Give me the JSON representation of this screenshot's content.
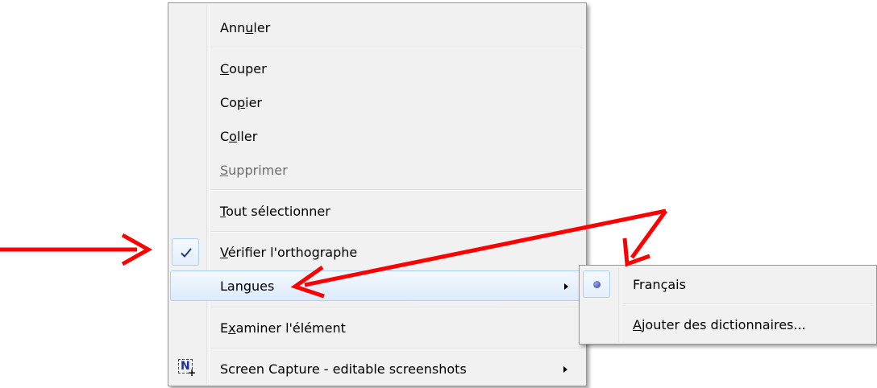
{
  "context_menu": {
    "items": [
      {
        "label_pre": "Ann",
        "accel": "u",
        "label_post": "ler"
      },
      {
        "label_pre": "",
        "accel": "C",
        "label_post": "ouper"
      },
      {
        "label_pre": "Co",
        "accel": "p",
        "label_post": "ier"
      },
      {
        "label_pre": "C",
        "accel": "o",
        "label_post": "ller"
      },
      {
        "label_pre": "",
        "accel": "S",
        "label_post": "upprimer",
        "disabled": true
      },
      {
        "label_pre": "",
        "accel": "T",
        "label_post": "out sélectionner"
      },
      {
        "label_pre": "",
        "accel": "V",
        "label_post": "érifier l'orthographe",
        "checked": true
      },
      {
        "label_pre": "Lan",
        "accel": "g",
        "label_post": "ues",
        "submenu": true,
        "highlighted": true
      },
      {
        "label_pre": "E",
        "accel": "x",
        "label_post": "aminer l'élément"
      },
      {
        "label_pre": "Screen Capture - editable screenshots",
        "accel": "",
        "label_post": "",
        "submenu": true,
        "icon": "screen-capture-icon"
      }
    ],
    "check_glyph": "✓",
    "screen_capture_icon_letter": "N",
    "screen_capture_icon_plus": "+"
  },
  "language_submenu": {
    "items": [
      {
        "label_pre": "Français",
        "accel": "",
        "label_post": "",
        "selected": true
      },
      {
        "label_pre": "",
        "accel": "A",
        "label_post": "jouter des dictionnaires..."
      }
    ]
  },
  "colors": {
    "annotation_arrow": "#ff0000",
    "menu_background": "#f1f1f1",
    "highlight_border": "#aecff7",
    "check_color": "#1c3a8c"
  }
}
